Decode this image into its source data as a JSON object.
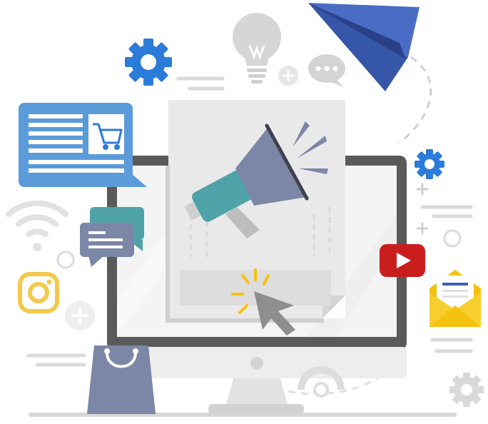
{
  "illustration": {
    "title": "",
    "icons": [
      "gear-icon",
      "lightbulb-icon",
      "plus-icon",
      "chat-bubble-icon",
      "paper-plane-icon",
      "webpage-shopping-cart-icon",
      "monitor-icon",
      "megaphone-icon",
      "cursor-click-icon",
      "wifi-icon",
      "message-bubbles-icon",
      "instagram-icon",
      "shopping-bag-icon",
      "youtube-play-icon",
      "email-envelope-icon",
      "gear-outline-icon"
    ]
  },
  "colors": {
    "blue_primary": "#2B7BD9",
    "blue_panel": "#5B9BD9",
    "navy_plane": "#3F5FB5",
    "slate": "#7C86A6",
    "teal": "#4FA3A8",
    "youtube_red": "#C81E1E",
    "envelope_yellow": "#F4C20D",
    "instagram_yellow": "#F2C94C",
    "monitor_frame": "#5A5A5A",
    "light_gray": "#E6E6E6",
    "mid_gray": "#C8C8C8"
  }
}
